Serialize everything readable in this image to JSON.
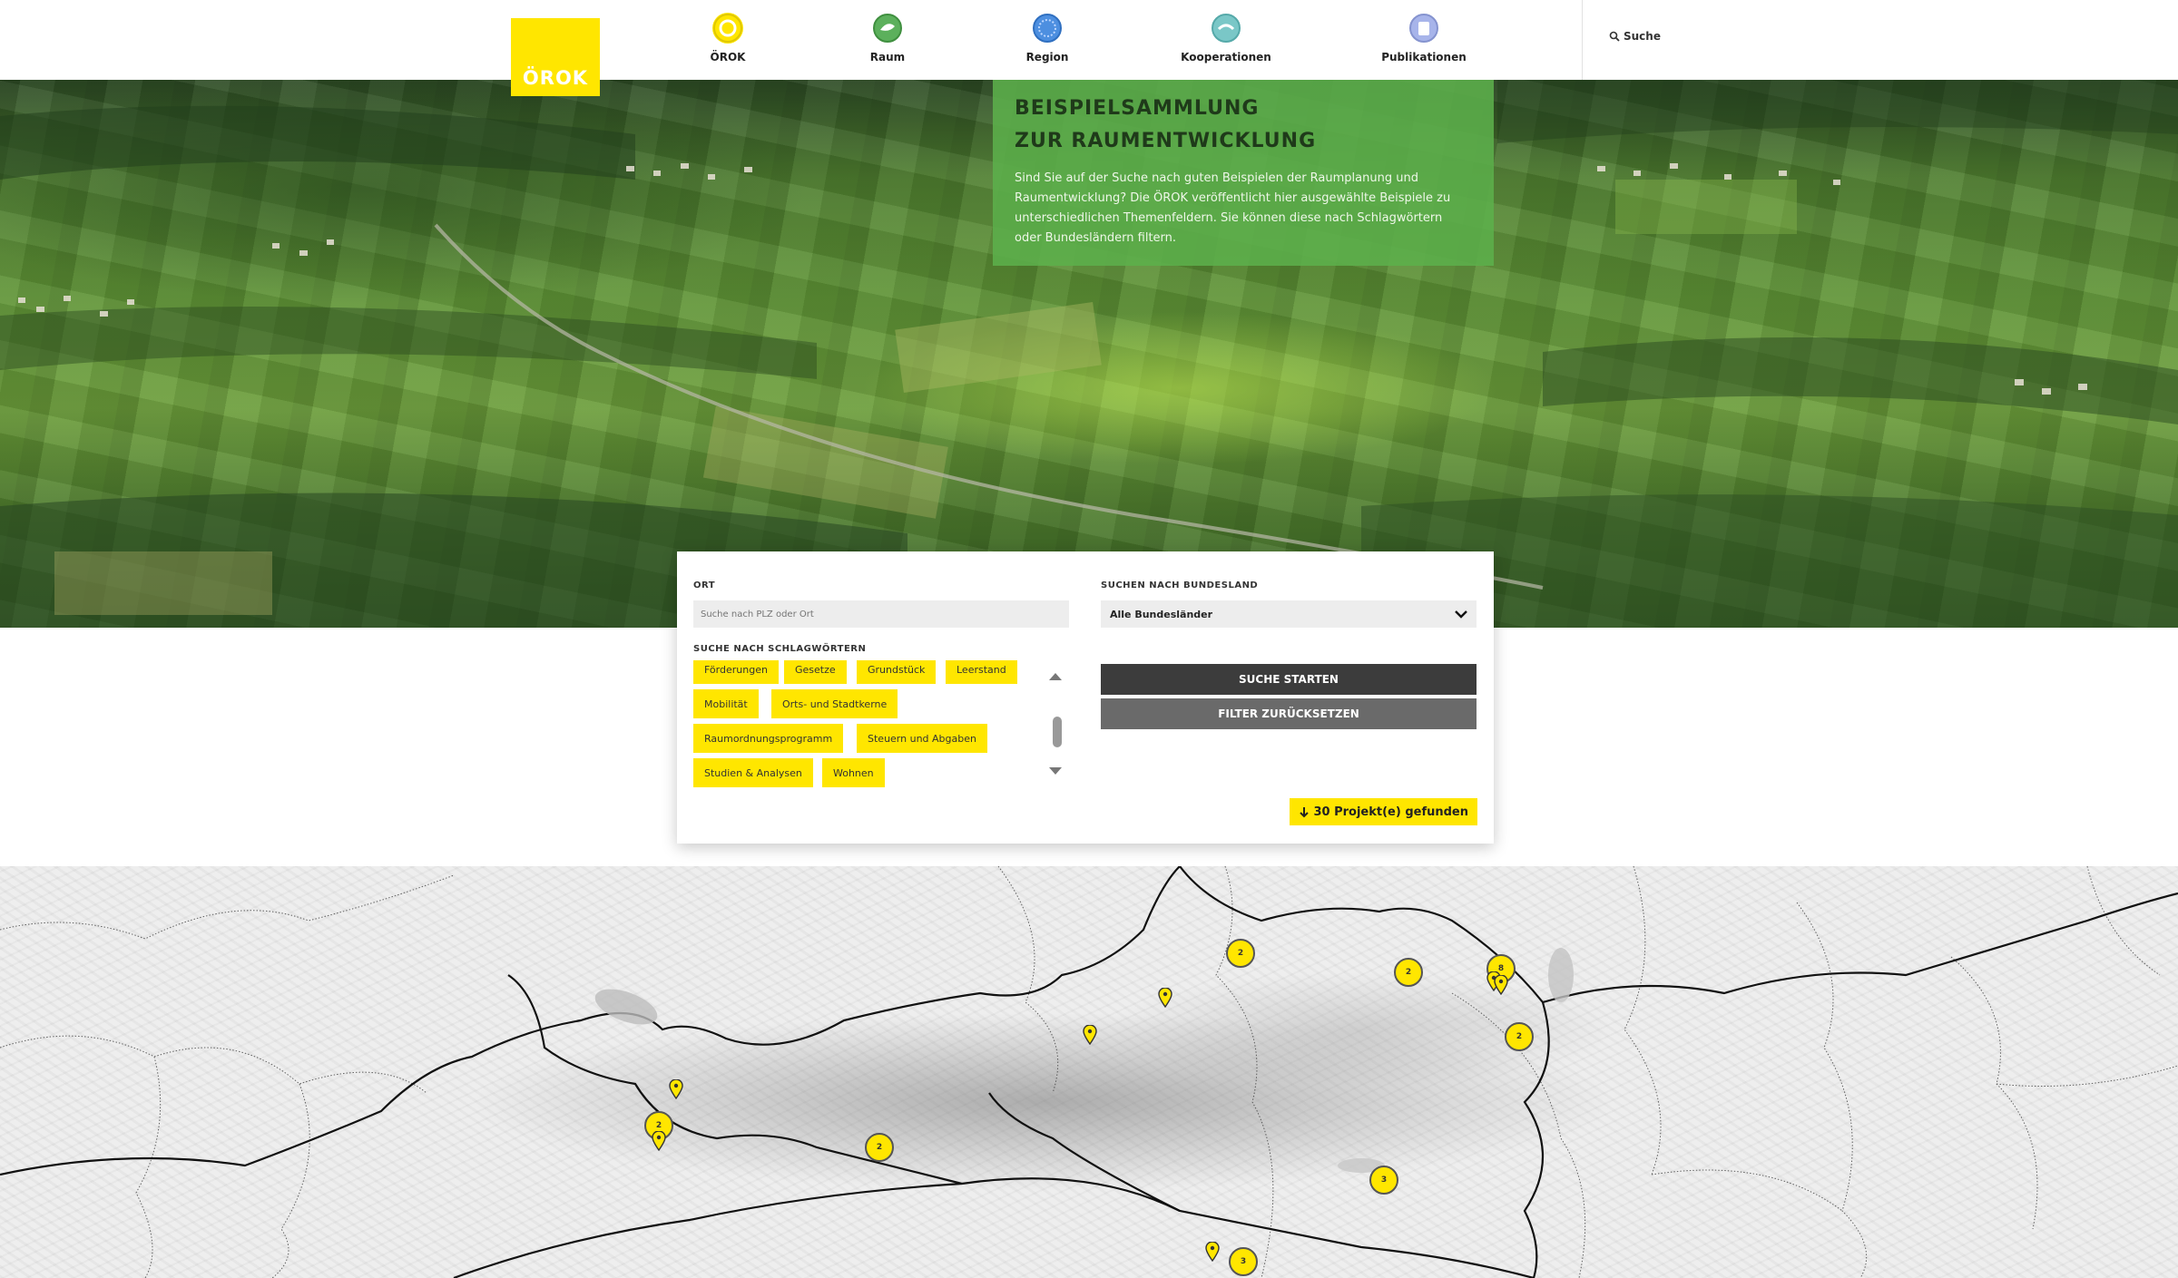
{
  "header": {
    "logo_text": "ÖROK",
    "nav": [
      {
        "label": "ÖROK",
        "icon": "orok-circle-icon",
        "color": "#ffe600"
      },
      {
        "label": "Raum",
        "icon": "raum-circle-icon",
        "color": "#5cb05c"
      },
      {
        "label": "Region",
        "icon": "region-circle-icon",
        "color": "#4d8fe0"
      },
      {
        "label": "Kooperationen",
        "icon": "kooperationen-circle-icon",
        "color": "#7ac7c7"
      },
      {
        "label": "Publikationen",
        "icon": "publikationen-circle-icon",
        "color": "#a7b4ea"
      }
    ],
    "search_label": "Suche"
  },
  "hero": {
    "title_line1": "BEISPIELSAMMLUNG",
    "title_line2": "ZUR RAUMENTWICKLUNG",
    "text": "Sind Sie auf der Suche nach guten Beispielen der Raumplanung und Raumentwicklung? Die ÖROK veröffentlicht hier ausgewählte Beispiele zu unterschiedlichen Themenfeldern. Sie können diese nach Schlagwörtern oder Bundesländern filtern."
  },
  "search": {
    "ort_label": "ORT",
    "ort_placeholder": "Suche nach PLZ oder Ort",
    "bundesland_label": "SUCHEN NACH BUNDESLAND",
    "bundesland_value": "Alle Bundesländer",
    "keywords_label": "SUCHE NACH SCHLAGWÖRTERN",
    "tags": [
      "Förderungen",
      "Gesetze",
      "Grundstück",
      "Leerstand",
      "Mobilität",
      "Orts- und Stadtkerne",
      "Raumordnungsprogramm",
      "Steuern und Abgaben",
      "Studien & Analysen",
      "Wohnen"
    ],
    "start_button": "SUCHE STARTEN",
    "reset_button": "FILTER ZURÜCKSETZEN",
    "found_text": "30 Projekt(e) gefunden"
  },
  "map": {
    "clusters": [
      "2",
      "2",
      "8",
      "2",
      "2",
      "2",
      "3",
      "3"
    ],
    "pin_count": 7
  },
  "colors": {
    "accent": "#ffe600",
    "hero_box": "#5caf4b",
    "button_dark": "#3c3c3c",
    "button_gray": "#6a6a6a"
  }
}
